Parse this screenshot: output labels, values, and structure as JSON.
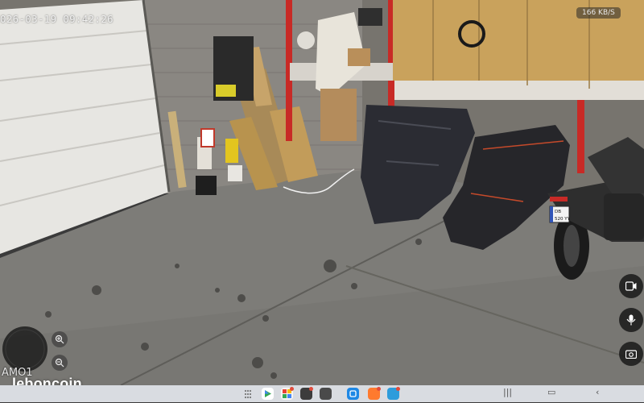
{
  "camera": {
    "timestamp": "026-03-19 09:42:26",
    "transfer_rate": "166 KB/S",
    "camera_name": "AMO1"
  },
  "watermark": {
    "text": "leboncoin"
  },
  "scene": {
    "license_plate": "DB\n520 YY"
  },
  "controls": {
    "joystick_icon": "joystick",
    "zoom_in_icon": "zoom-in",
    "zoom_out_icon": "zoom-out",
    "side_buttons": [
      "video-record",
      "microphone",
      "snapshot"
    ]
  },
  "taskbar": {
    "apps": [
      "app-1",
      "app-2",
      "app-3",
      "app-4",
      "app-5",
      "app-6",
      "app-7",
      "app-8"
    ],
    "nav_buttons": [
      "recent-apps",
      "home",
      "back"
    ]
  },
  "colors": {
    "accent": "#c82a26",
    "taskbar": "#d9dce1"
  }
}
